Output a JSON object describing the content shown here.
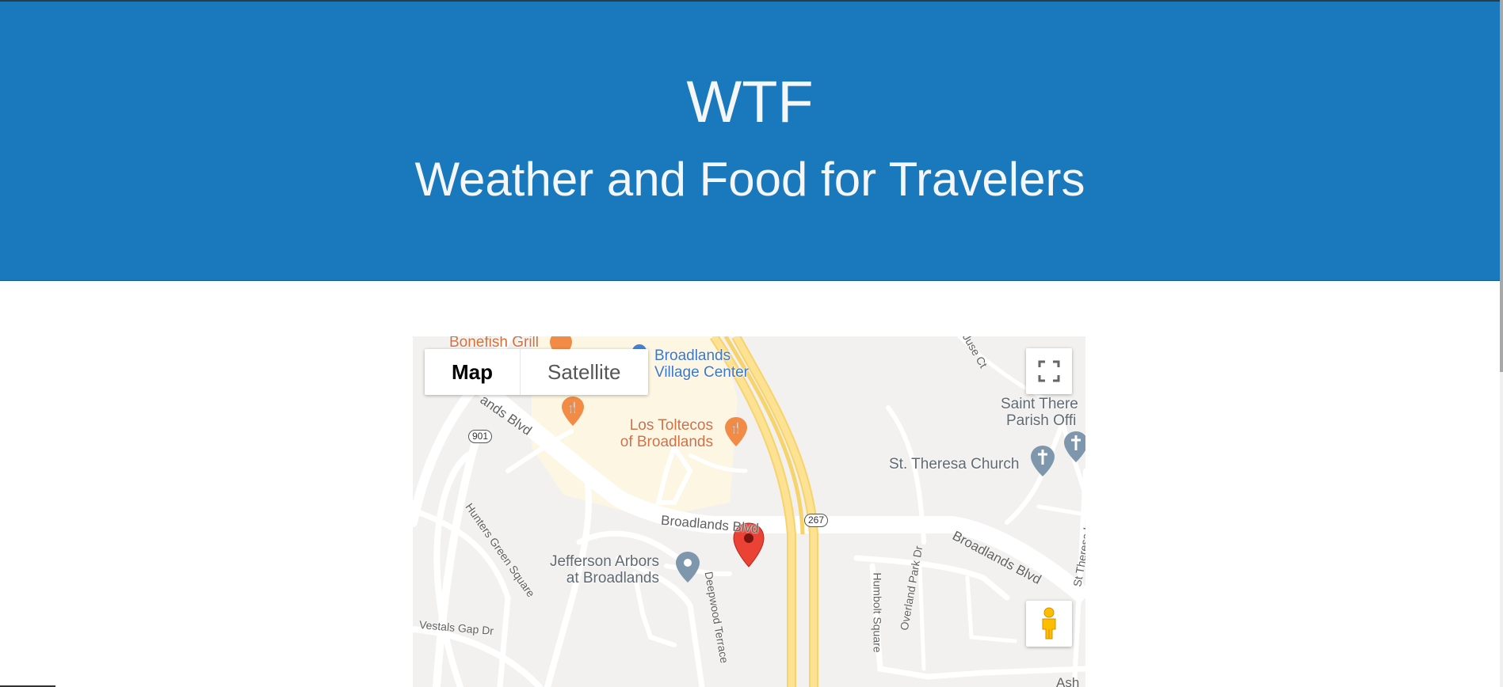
{
  "header": {
    "title": "WTF",
    "subtitle": "Weather and Food for Travelers",
    "background": "#1a78bd"
  },
  "map": {
    "type_control": {
      "map_label": "Map",
      "satellite_label": "Satellite",
      "selected": "Map"
    },
    "places": {
      "bonefish": "Bonefish Grill",
      "broadlands_village_1": "Broadlands",
      "broadlands_village_2": "Village Center",
      "los_toltecos_1": "Los Toltecos",
      "los_toltecos_2": "of Broadlands",
      "saint_theresa_parish_1": "Saint There",
      "saint_theresa_parish_2": "Parish Offi",
      "st_theresa_church": "St. Theresa Church",
      "jefferson_arbors_1": "Jefferson Arbors",
      "jefferson_arbors_2": "at Broadlands"
    },
    "roads": {
      "broadlands_blvd_nw": "ands Blvd",
      "broadlands_blvd_center": "Broadlands Blvd",
      "broadlands_blvd_east": "Broadlands Blvd",
      "hunters_green": "Hunters Green Square",
      "deepwood": "Deepwood Terrace",
      "vestals_gap": "Vestals Gap Dr",
      "humbolt": "Humbolt Square",
      "overland_park": "Overland Park Dr",
      "st_theresa_ln": "St Theresa Ln",
      "juse_ct": "Juse Ct",
      "ash": "Ash"
    },
    "route_shields": {
      "r901": "901",
      "r267": "267"
    },
    "icons": {
      "marker": "red-location-marker-icon",
      "food": "restaurant-icon",
      "church": "church-icon",
      "place": "place-icon",
      "fullscreen": "fullscreen-icon",
      "pegman": "pegman-icon"
    }
  }
}
